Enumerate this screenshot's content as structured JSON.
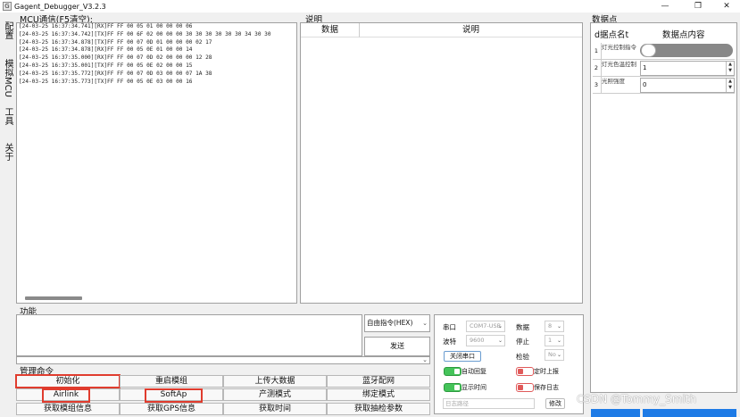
{
  "window": {
    "title": "Gagent_Debugger_V3.2.3",
    "controls": {
      "minimize": "—",
      "restore": "❐",
      "close": "✕"
    }
  },
  "left_tabs": [
    "配置",
    "模拟MCU",
    "工具",
    "关于"
  ],
  "mcu_log": {
    "label": "MCU通信(F5清空):",
    "lines": [
      "[24-03-25 16:37:34.741][RX]FF FF 00 05 01 00 00 00 06",
      "[24-03-25 16:37:34.742][TX]FF FF 00 6F 02 00 00 00 30 30 30 30 30 30 34 30 30",
      "[24-03-25 16:37:34.878][TX]FF FF 00 07 0D 01 00 00 00 02 17",
      "[24-03-25 16:37:34.878][RX]FF FF 00 05 0E 01 00 00 14",
      "[24-03-25 16:37:35.000][RX]FF FF 00 07 0D 02 00 00 00 12 28",
      "[24-03-25 16:37:35.001][TX]FF FF 00 05 0E 02 00 00 15",
      "[24-03-25 16:37:35.772][RX]FF FF 00 07 0D 03 00 00 07 1A 38",
      "[24-03-25 16:37:35.773][TX]FF FF 00 05 0E 03 00 00 16"
    ]
  },
  "description": {
    "label": "说明",
    "col_data": "数据",
    "col_desc": "说明"
  },
  "datapoints": {
    "label": "数据点",
    "col_name": "d据点名t",
    "col_content": "数据点内容",
    "rows": [
      {
        "index": "1",
        "name": "灯光控制指令",
        "type": "toggle",
        "value": ""
      },
      {
        "index": "2",
        "name": "灯光色温控制",
        "type": "number",
        "value": "1"
      },
      {
        "index": "3",
        "name": "光照强度",
        "type": "number",
        "value": "0"
      }
    ]
  },
  "function": {
    "label": "功能",
    "command_select": "自由指令(HEX)",
    "send_button": "发送"
  },
  "management": {
    "label": "管理命令",
    "buttons": [
      [
        "初始化",
        "重启模组",
        "上传大数据",
        "蓝牙配网"
      ],
      [
        "Airlink",
        "SoftAp",
        "产测模式",
        "绑定模式"
      ],
      [
        "获取模组信息",
        "获取GPS信息",
        "获取时间",
        "获取抽检参数"
      ]
    ],
    "highlight_color": "#e03c2e"
  },
  "serial": {
    "port_label": "串口",
    "port_value": "COM7-USB",
    "data_label": "数据",
    "data_value": "8",
    "baud_label": "波特",
    "baud_value": "9600",
    "stop_label": "停止",
    "stop_value": "1",
    "close_port_button": "关闭串口",
    "parity_label": "检验",
    "parity_value": "No",
    "auto_reply": "自动回复",
    "timed_report": "定时上报",
    "show_time": "显示时间",
    "save_log": "保存日志",
    "log_path_placeholder": "日志路径",
    "modify_button": "修改"
  },
  "watermark": "CSDN @Tommy_Smith",
  "colors": {
    "switch_on": "#45c45a",
    "switch_off_border": "#e05a5a",
    "accent": "#1e7be6"
  }
}
